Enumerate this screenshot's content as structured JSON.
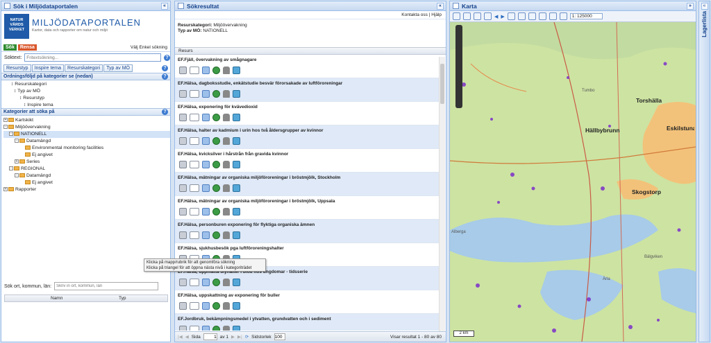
{
  "left": {
    "title": "Sök i Miljödataportalen",
    "logo_text": "NATUR\nVÅRDS\nVERKET",
    "portal_name": "MILJÖDATAPORTALEN",
    "portal_sub": "Kartor, data och rapporter om natur och miljö",
    "tab_sok": "Sök",
    "tab_rensa": "Rensa",
    "simple_link": "Välj Enkel sökning",
    "soktext_label": "Söktext:",
    "soktext_placeholder": "Fritextsökning...",
    "cat_tabs": [
      "Resurstyp",
      "Inspire tema",
      "Resurskategori",
      "Typ av MÖ"
    ],
    "order_title": "Ordningsföljd på kategorier se (nedan)",
    "order_items": [
      "Resurskategori",
      "Typ av MÖ",
      "Resurstyp",
      "Inspire tema"
    ],
    "cat_title": "Kategorier att söka på",
    "tree": [
      {
        "t": "Kartskikt",
        "lvl": 0,
        "tg": "+"
      },
      {
        "t": "Miljöövervakning",
        "lvl": 0,
        "tg": "-"
      },
      {
        "t": "NATIONELL",
        "lvl": 1,
        "tg": "-",
        "sel": true
      },
      {
        "t": "Datamängd",
        "lvl": 2,
        "tg": "-"
      },
      {
        "t": "Environmental monitoring facilities",
        "lvl": 3,
        "tg": ""
      },
      {
        "t": "Ej angivet",
        "lvl": 3,
        "tg": ""
      },
      {
        "t": "Series",
        "lvl": 2,
        "tg": "+"
      },
      {
        "t": "REGIONAL",
        "lvl": 1,
        "tg": "-"
      },
      {
        "t": "Datamängd",
        "lvl": 2,
        "tg": "-"
      },
      {
        "t": "Ej angivet",
        "lvl": 3,
        "tg": ""
      },
      {
        "t": "Rapporter",
        "lvl": 0,
        "tg": "+"
      }
    ],
    "place_label": "Sök ort, kommun, län:",
    "place_placeholder": "Skriv in ort, kommun, län",
    "col_namn": "Namn",
    "col_typ": "Typ"
  },
  "mid": {
    "title": "Sökresultat",
    "kontakta": "Kontakta oss",
    "hjalp": "Hjälp",
    "crit1_label": "Resurskategori:",
    "crit1_val": "Miljöövervakning",
    "crit2_label": "Typ av MÖ:",
    "crit2_val": "NATIONELL",
    "col_resurs": "Resurs",
    "results": [
      "EF.Fjäll, övervakning av smågnagare",
      "EF.Hälsa, dagboksstudie, enkätstudie besvär förorsakade av luftföroreningar",
      "EF.Hälsa, exponering för kvävedioxid",
      "EF.Hälsa, halter av kadmium i urin hos två åldersgrupper av kvinnor",
      "EF.Hälsa, kvicksilver i hårstrån från gravida kvinnor",
      "EF.Hälsa, mätningar av organiska miljöföroreningar i bröstmjölk, Stockholm",
      "EF.Hälsa, mätningar av organiska miljöföroreningar i bröstmjölk, Uppsala",
      "EF.Hälsa, personburen exponering för flyktiga organiska ämnen",
      "EF.Hälsa, sjukhusbesök pga luftföroreningshalter",
      "EF.Hälsa, uppmätta blyhalter i blod hos ungdomar - tidsserie",
      "EF.Hälsa, uppskattning av exponering för buller",
      "EF.Jordbruk, bekämpningsmedel i ytvatten, grundvatten och i sediment"
    ],
    "tooltip1": "Klicka på mapp/rubrik för att genomföra sökning",
    "tooltip2": "Klicka på triangel för att öppna nästa nivå i kategoriträdet",
    "sida": "Sida",
    "page": "1",
    "av": "av 1",
    "sidstorlek": "Sidstorlek",
    "size": "100",
    "visar": "Visar resultat 1 - 80 av 80"
  },
  "map": {
    "title": "Karta",
    "scale": "1: 125000",
    "scalebar": "2 km",
    "places": [
      "Torshälla",
      "Hällbybrunn",
      "Eskilstuna",
      "Skogstorp",
      "Tumbo",
      "Ärla",
      "Alberga",
      "Bälgviken"
    ],
    "layerlist": "Lagerlista"
  }
}
